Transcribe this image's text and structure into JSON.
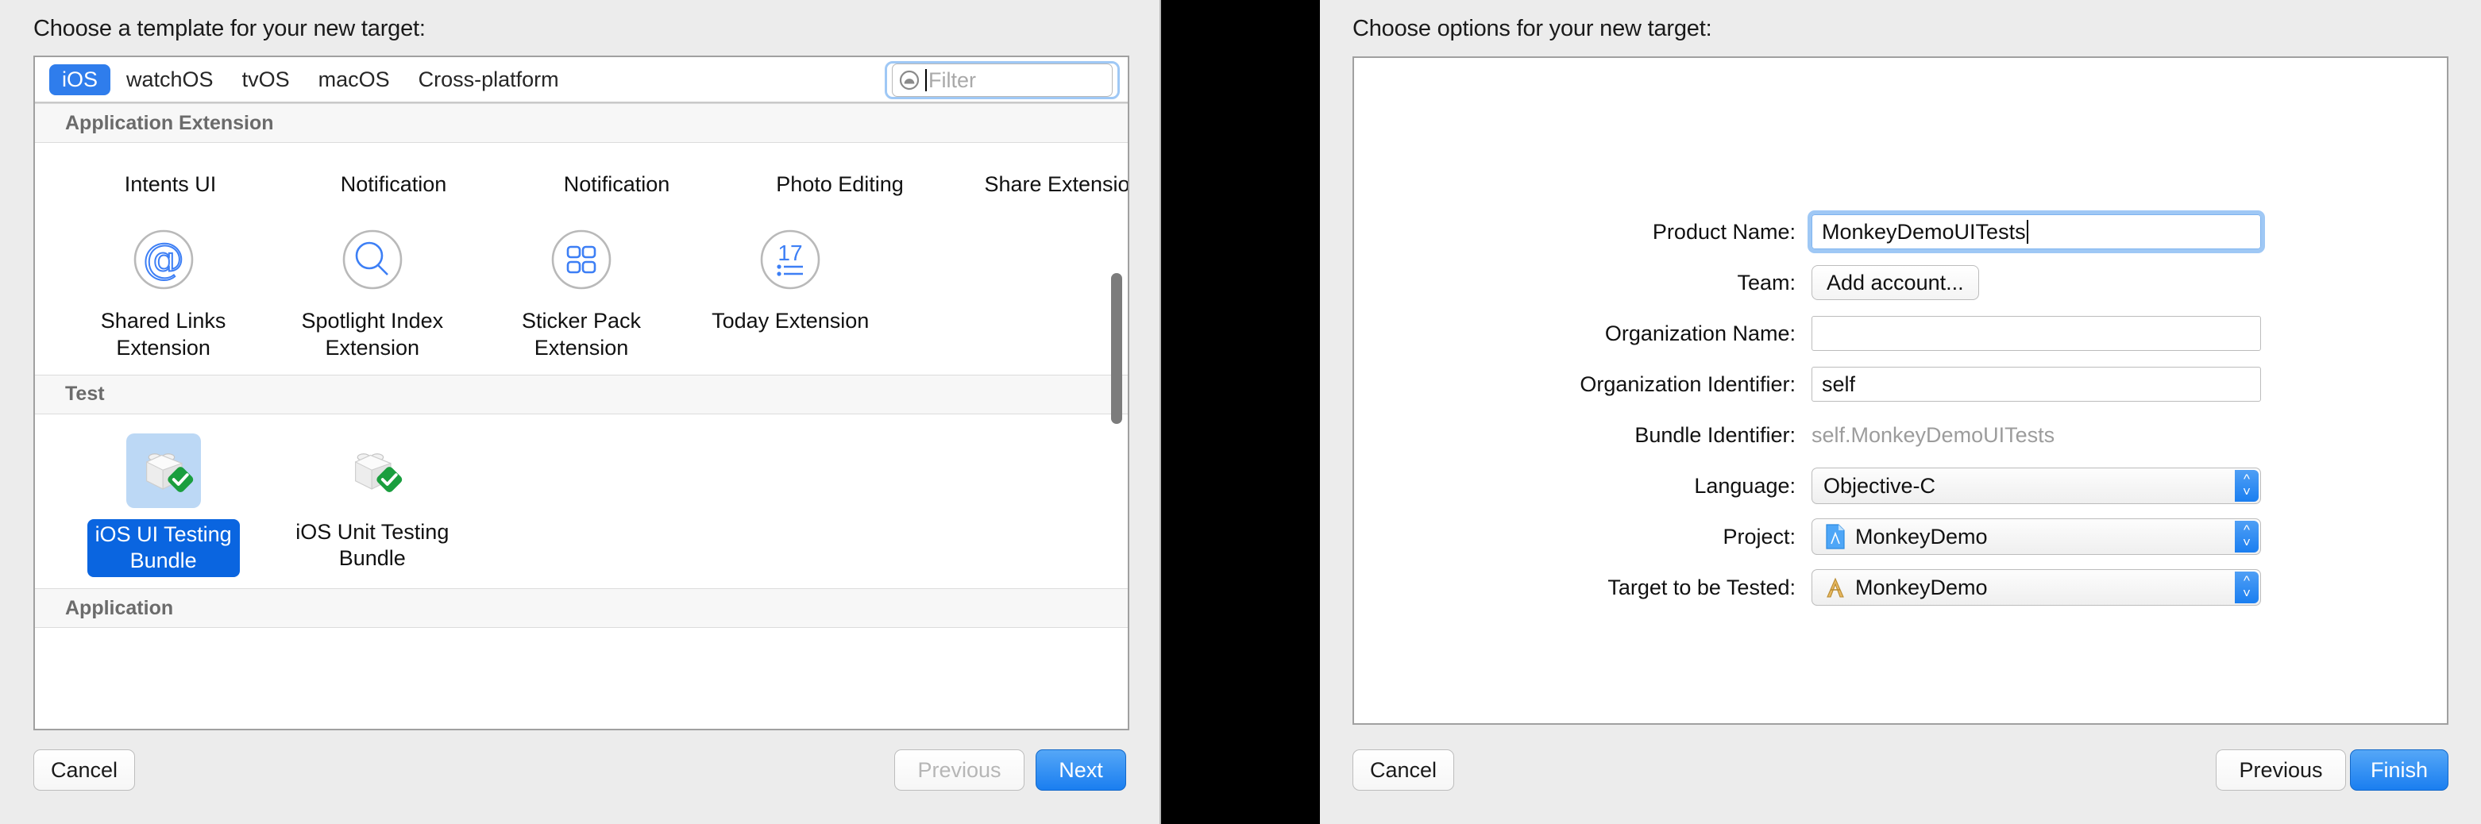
{
  "left_dialog": {
    "title": "Choose a template for your new target:",
    "platform_tabs": [
      {
        "label": "iOS",
        "active": true
      },
      {
        "label": "watchOS",
        "active": false
      },
      {
        "label": "tvOS",
        "active": false
      },
      {
        "label": "macOS",
        "active": false
      },
      {
        "label": "Cross-platform",
        "active": false
      }
    ],
    "filter": {
      "placeholder": "Filter",
      "value": ""
    },
    "sections": [
      {
        "header": "Application Extension",
        "clipped_row_labels": [
          "Intents UI\nExtension",
          "Notification\nContent\nExtension",
          "Notification\nService Extension",
          "Photo Editing\nExtension",
          "Share Extension"
        ],
        "items": [
          {
            "label": "Shared Links\nExtension",
            "icon": "at-sign-icon"
          },
          {
            "label": "Spotlight Index\nExtension",
            "icon": "magnifier-icon"
          },
          {
            "label": "Sticker Pack\nExtension",
            "icon": "four-squares-icon"
          },
          {
            "label": "Today Extension",
            "icon": "today-list-icon"
          }
        ]
      },
      {
        "header": "Test",
        "items": [
          {
            "label": "iOS UI Testing\nBundle",
            "icon": "test-bundle-icon",
            "selected": true
          },
          {
            "label": "iOS Unit Testing\nBundle",
            "icon": "test-bundle-icon",
            "selected": false
          }
        ]
      },
      {
        "header": "Application",
        "items": [
          {
            "label": "",
            "icon": "single-view-app-icon"
          },
          {
            "label": "",
            "icon": "game-app-icon"
          },
          {
            "label": "",
            "icon": "master-detail-app-icon"
          },
          {
            "label": "",
            "icon": "page-based-app-icon"
          },
          {
            "label": "",
            "icon": "tabbed-app-icon"
          }
        ]
      }
    ],
    "buttons": {
      "cancel": "Cancel",
      "previous": "Previous",
      "next": "Next"
    },
    "previous_disabled": true
  },
  "right_dialog": {
    "title": "Choose options for your new target:",
    "fields": [
      {
        "label": "Product Name:",
        "type": "text",
        "value": "MonkeyDemoUITests",
        "focused": true
      },
      {
        "label": "Team:",
        "type": "button",
        "value": "Add account..."
      },
      {
        "label": "Organization Name:",
        "type": "text",
        "value": "",
        "focused": false
      },
      {
        "label": "Organization Identifier:",
        "type": "text",
        "value": "self",
        "focused": false
      },
      {
        "label": "Bundle Identifier:",
        "type": "static",
        "value": "self.MonkeyDemoUITests"
      },
      {
        "label": "Language:",
        "type": "popup",
        "value": "Objective-C",
        "icon": null
      },
      {
        "label": "Project:",
        "type": "popup",
        "value": "MonkeyDemo",
        "icon": "xcode-project-icon"
      },
      {
        "label": "Target to be Tested:",
        "type": "popup",
        "value": "MonkeyDemo",
        "icon": "xcode-target-icon"
      }
    ],
    "buttons": {
      "cancel": "Cancel",
      "previous": "Previous",
      "finish": "Finish"
    }
  },
  "colors": {
    "accent_blue": "#2f7dec",
    "selection_blue": "#0a65e0",
    "focus_ring": "#9fc8f5",
    "icon_blue": "#3d7ff5",
    "check_green": "#1a9e3e"
  }
}
